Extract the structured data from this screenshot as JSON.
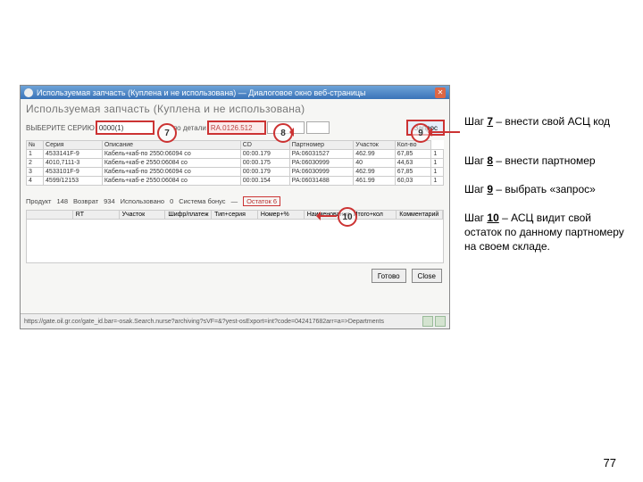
{
  "window": {
    "title": "Используемая запчасть (Куплена и не использована) — Диалоговое окно веб-страницы",
    "heading": "Используемая запчасть (Куплена и не использована)"
  },
  "filters": {
    "label1": "ВЫБЕРИТЕ СЕРИЮ",
    "input7": "0000(1)",
    "label2": "по детали",
    "input8": "RA.0126.512",
    "query_btn": "Запрос"
  },
  "grid": {
    "headers": [
      "№",
      "Серия",
      "Описание",
      "CD",
      "Партномер",
      "Участок",
      "Кол-во"
    ],
    "rows": [
      [
        "1",
        "4533141F-9",
        "Кабель+каб-по   2550:06094 со",
        "00:00.179",
        "РА:06031527",
        "462.99",
        "67,85",
        "1"
      ],
      [
        "2",
        "4010,7111-3",
        "Кабель+каб-е    2550:06084 со",
        "00:00.175",
        "РА:06030999",
        "40",
        "44,63",
        "1"
      ],
      [
        "3",
        "4533101F-9",
        "Кабель+каб-по   2550:06094 со",
        "00:00.179",
        "РА:06030999",
        "462.99",
        "67,85",
        "1"
      ],
      [
        "4",
        "4599/12153",
        "Кабель+каб-е    2550:06084 со",
        "00:00.154",
        "РА:06031488",
        "461.99",
        "60,03",
        "1"
      ]
    ]
  },
  "midrow": {
    "a": "Продукт",
    "av": "148",
    "b": "Возврат",
    "bv": "934",
    "c": "Использовано",
    "cv": "0",
    "d": "Система бонус",
    "dv": "—",
    "e": "Остаток",
    "ev": "6"
  },
  "lower_headers": [
    "",
    "RT",
    "Участок",
    "Шифр/платеж",
    "Тип+серия",
    "Номер+%",
    "Наименование",
    "Итого+кол",
    "Комментарий"
  ],
  "bottom": {
    "ok": "Готово",
    "close": "Close"
  },
  "status": "https://gate.oil.gr.cor/gate_id.bar=-osak.Search.nurse?archiving?sVF=&?yest-osExport=int?code=042417682arr=a=>Departments",
  "labels": {
    "c7": "7",
    "c8": "8",
    "c9": "9",
    "c10": "10"
  },
  "instr": {
    "s7a": "Шаг ",
    "s7n": "7",
    "s7b": " – внести свой АСЦ код",
    "s8a": "Шаг ",
    "s8n": "8",
    "s8b": " – внести партномер",
    "s9a": "Шаг ",
    "s9n": "9",
    "s9b": " – выбрать «запрос»",
    "s10a": "Шаг ",
    "s10n": "10",
    "s10b": " – АСЦ видит свой остаток по данному партномеру на своем складе."
  },
  "page": "77"
}
